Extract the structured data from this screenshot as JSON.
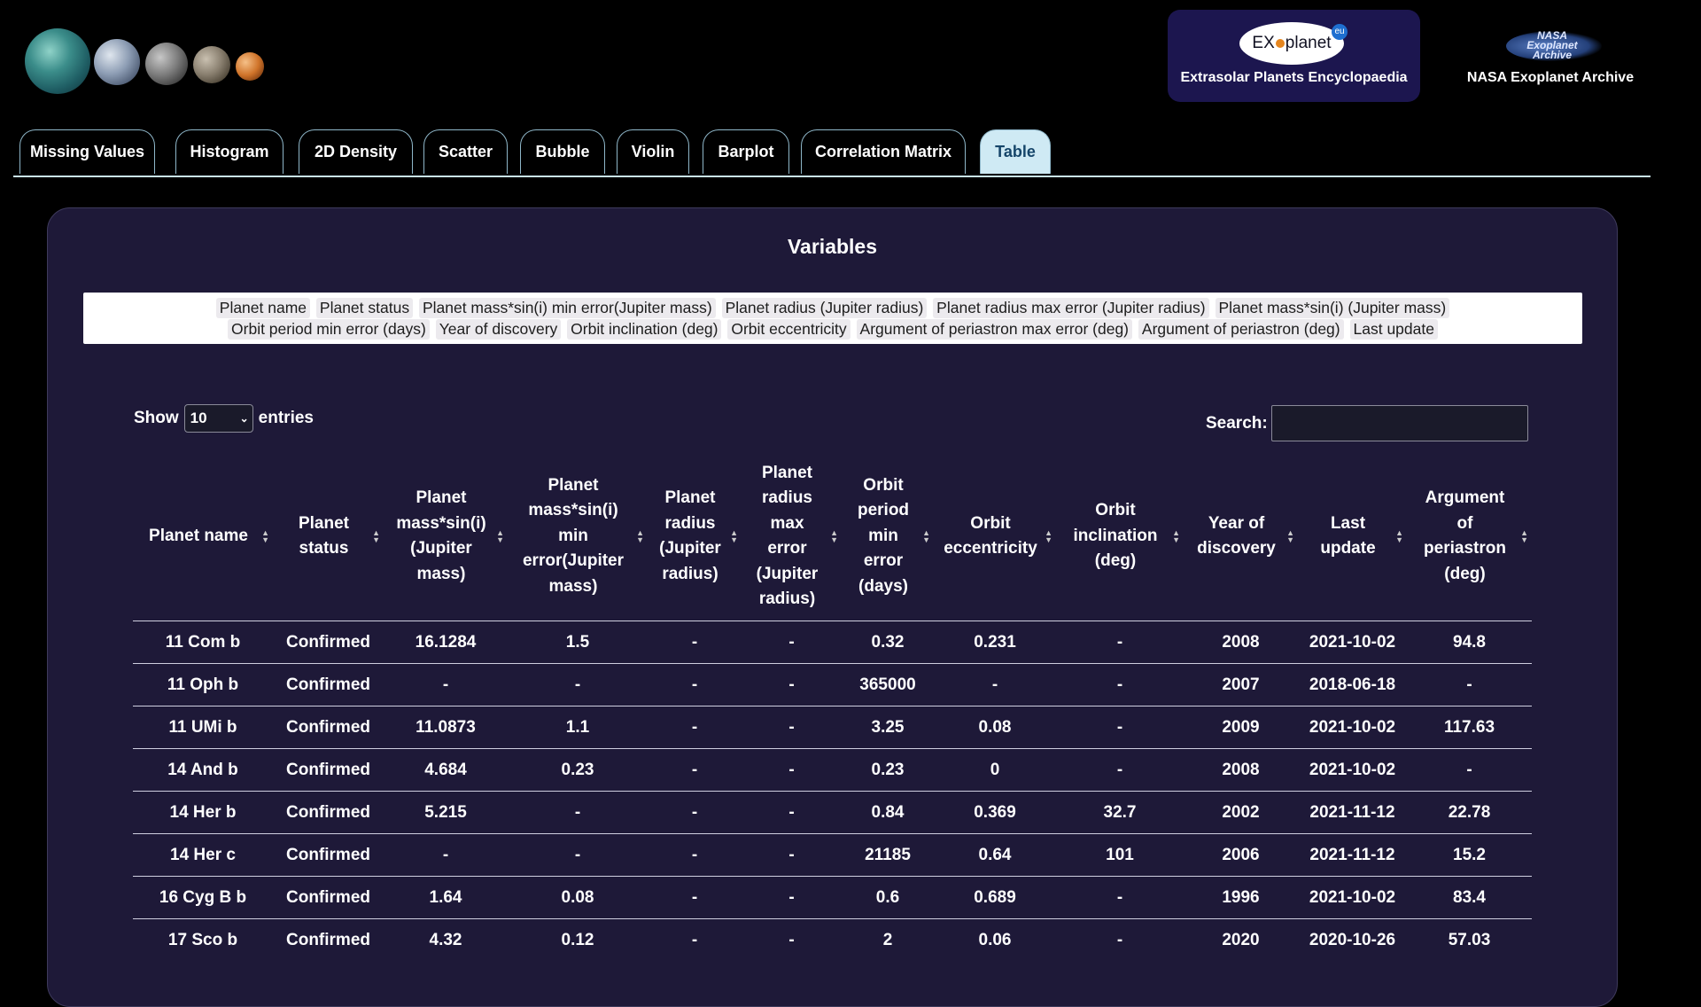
{
  "header": {
    "exoplanet_logo_text": "EXOplanet",
    "exoplanet_logo_badge": "eu",
    "exoplanet_title": "Extrasolar Planets Encyclopaedia",
    "nasa_logo_text": [
      "NASA",
      "Exoplanet",
      "Archive"
    ],
    "nasa_title": "NASA Exoplanet Archive"
  },
  "tabs": [
    {
      "label": "Missing Values",
      "active": false
    },
    {
      "label": "Histogram",
      "active": false
    },
    {
      "label": "2D Density",
      "active": false
    },
    {
      "label": "Scatter",
      "active": false
    },
    {
      "label": "Bubble",
      "active": false
    },
    {
      "label": "Violin",
      "active": false
    },
    {
      "label": "Barplot",
      "active": false
    },
    {
      "label": "Correlation Matrix",
      "active": false
    },
    {
      "label": "Table",
      "active": true
    }
  ],
  "panel": {
    "title": "Variables",
    "variables_line1": [
      "Planet name",
      "Planet status",
      "Planet mass*sin(i) min error(Jupiter mass)",
      "Planet radius (Jupiter radius)",
      "Planet radius max error (Jupiter radius)",
      "Planet mass*sin(i) (Jupiter mass)"
    ],
    "variables_line2": [
      "Orbit period min error (days)",
      "Year of discovery",
      "Orbit inclination (deg)",
      "Orbit eccentricity",
      "Argument of periastron max error (deg)",
      "Argument of periastron (deg)",
      "Last update"
    ]
  },
  "controls": {
    "show_label": "Show",
    "entries_value": "10",
    "entries_label": "entries",
    "search_label": "Search:",
    "search_value": ""
  },
  "table": {
    "columns": [
      [
        "Planet name"
      ],
      [
        "Planet",
        "status"
      ],
      [
        "Planet",
        "mass*sin(i)",
        "(Jupiter",
        "mass)"
      ],
      [
        "Planet",
        "mass*sin(i)",
        "min",
        "error(Jupiter",
        "mass)"
      ],
      [
        "Planet",
        "radius",
        "(Jupiter",
        "radius)"
      ],
      [
        "Planet",
        "radius",
        "max",
        "error",
        "(Jupiter",
        "radius)"
      ],
      [
        "Orbit",
        "period",
        "min",
        "error",
        "(days)"
      ],
      [
        "Orbit",
        "eccentricity"
      ],
      [
        "Orbit",
        "inclination",
        "(deg)"
      ],
      [
        "Year of",
        "discovery"
      ],
      [
        "Last",
        "update"
      ],
      [
        "Argument",
        "of",
        "periastron",
        "(deg)"
      ]
    ],
    "rows": [
      [
        "11 Com b",
        "Confirmed",
        "16.1284",
        "1.5",
        "-",
        "-",
        "0.32",
        "0.231",
        "-",
        "2008",
        "2021-10-02",
        "94.8"
      ],
      [
        "11 Oph b",
        "Confirmed",
        "-",
        "-",
        "-",
        "-",
        "365000",
        "-",
        "-",
        "2007",
        "2018-06-18",
        "-"
      ],
      [
        "11 UMi b",
        "Confirmed",
        "11.0873",
        "1.1",
        "-",
        "-",
        "3.25",
        "0.08",
        "-",
        "2009",
        "2021-10-02",
        "117.63"
      ],
      [
        "14 And b",
        "Confirmed",
        "4.684",
        "0.23",
        "-",
        "-",
        "0.23",
        "0",
        "-",
        "2008",
        "2021-10-02",
        "-"
      ],
      [
        "14 Her b",
        "Confirmed",
        "5.215",
        "-",
        "-",
        "-",
        "0.84",
        "0.369",
        "32.7",
        "2002",
        "2021-11-12",
        "22.78"
      ],
      [
        "14 Her c",
        "Confirmed",
        "-",
        "-",
        "-",
        "-",
        "21185",
        "0.64",
        "101",
        "2006",
        "2021-11-12",
        "15.2"
      ],
      [
        "16 Cyg B b",
        "Confirmed",
        "1.64",
        "0.08",
        "-",
        "-",
        "0.6",
        "0.689",
        "-",
        "1996",
        "2021-10-02",
        "83.4"
      ],
      [
        "17 Sco b",
        "Confirmed",
        "4.32",
        "0.12",
        "-",
        "-",
        "2",
        "0.06",
        "-",
        "2020",
        "2020-10-26",
        "57.03"
      ]
    ]
  }
}
